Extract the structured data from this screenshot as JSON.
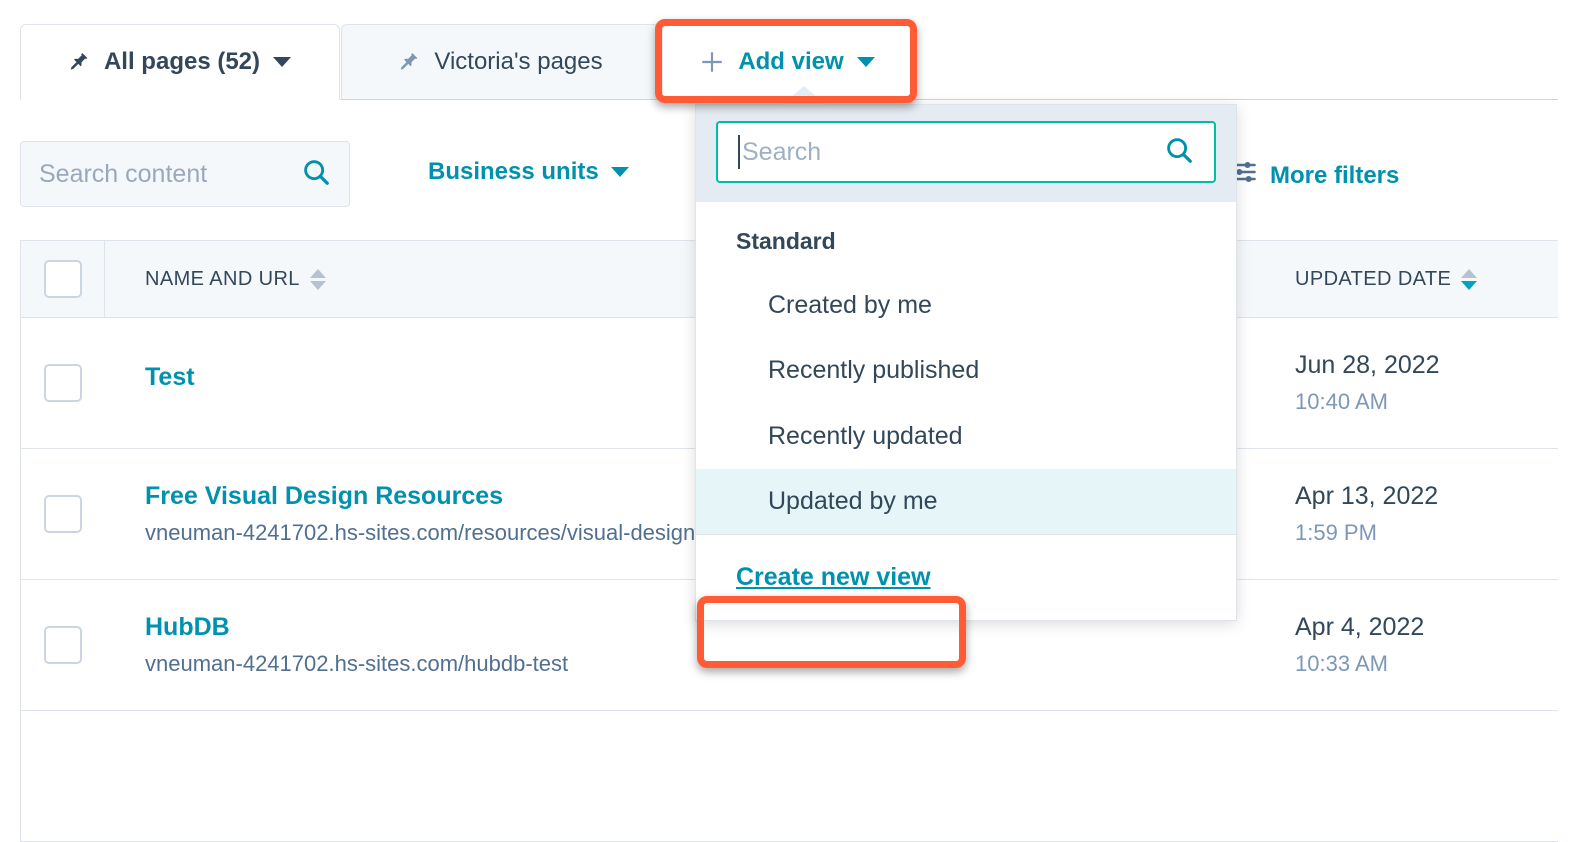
{
  "tabs": [
    {
      "label": "All pages (52)",
      "icon": "pin-icon",
      "active": true,
      "has_caret": true
    },
    {
      "label": "Victoria's pages",
      "icon": "pin-icon",
      "active": false,
      "has_caret": false
    },
    {
      "label": "Add view",
      "icon": "plus-icon",
      "active": false,
      "has_caret": true
    }
  ],
  "filters": {
    "search_placeholder": "Search content",
    "search_value": "",
    "search_icon": "search-icon",
    "business_units_label": "Business units",
    "more_filters_label": "More filters",
    "more_filters_icon": "sliders-icon"
  },
  "table": {
    "columns": [
      {
        "key": "select",
        "label": ""
      },
      {
        "key": "name",
        "label": "NAME AND URL",
        "sort": "none"
      },
      {
        "key": "updated",
        "label": "UPDATED DATE",
        "sort": "desc"
      }
    ],
    "rows": [
      {
        "title": "Test",
        "url": "",
        "date": "Jun 28, 2022",
        "time": "10:40 AM"
      },
      {
        "title": "Free Visual Design Resources",
        "url": "vneuman-4241702.hs-sites.com/resources/visual-design",
        "date": "Apr 13, 2022",
        "time": "1:59 PM"
      },
      {
        "title": "HubDB",
        "url": "vneuman-4241702.hs-sites.com/hubdb-test",
        "date": "Apr 4, 2022",
        "time": "10:33 AM"
      }
    ]
  },
  "dropdown": {
    "search_placeholder": "Search",
    "search_value": "",
    "search_icon": "search-icon",
    "group_label": "Standard",
    "items": [
      {
        "label": "Created by me",
        "selected": false
      },
      {
        "label": "Recently published",
        "selected": false
      },
      {
        "label": "Recently updated",
        "selected": false
      },
      {
        "label": "Updated by me",
        "selected": true
      }
    ],
    "create_label": "Create new view"
  },
  "annotations": {
    "highlight_color": "#ff5c35",
    "boxes": [
      {
        "name": "add-view-highlight"
      },
      {
        "name": "create-new-view-highlight"
      }
    ]
  },
  "colors": {
    "teal": "#0091ae",
    "navy": "#33475b",
    "orange": "#ff5c35",
    "selected_row": "#e5f5f8",
    "header_bg": "#f5f8fa"
  }
}
